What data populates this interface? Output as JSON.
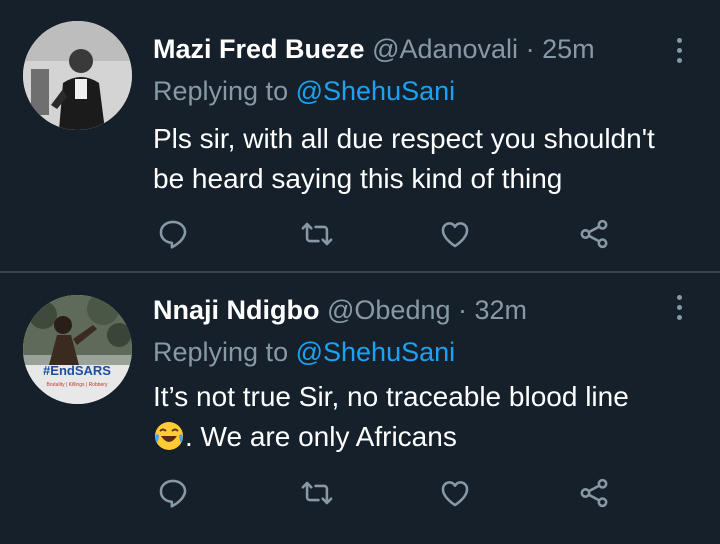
{
  "tweets": [
    {
      "name": "Mazi Fred Bueze",
      "handle": "@Adanovali",
      "time": "25m",
      "replying_label": "Replying to",
      "replying_to": "@ShehuSani",
      "text_lines": [
        "Pls sir, with all due respect you shouldn't",
        "be heard saying this kind of thing"
      ]
    },
    {
      "name": "Nnaji Ndigbo",
      "handle": "@Obedng",
      "time": "32m",
      "replying_label": "Replying to",
      "replying_to": "@ShehuSani",
      "text_line1": "It’s not true Sir, no traceable blood line",
      "text_line2": ". We are only Africans",
      "avatar_badge": {
        "title": "#EndSARS",
        "subtitle": "Brutality | Killings | Robbery"
      }
    }
  ],
  "separator": " · ",
  "colors": {
    "background": "#15202b",
    "secondary_text": "#8899a6",
    "mention": "#1da1f2",
    "divider": "#38444d"
  },
  "icons": [
    "reply-icon",
    "retweet-icon",
    "like-icon",
    "share-icon",
    "more-icon",
    "laughing-emoji-icon"
  ]
}
